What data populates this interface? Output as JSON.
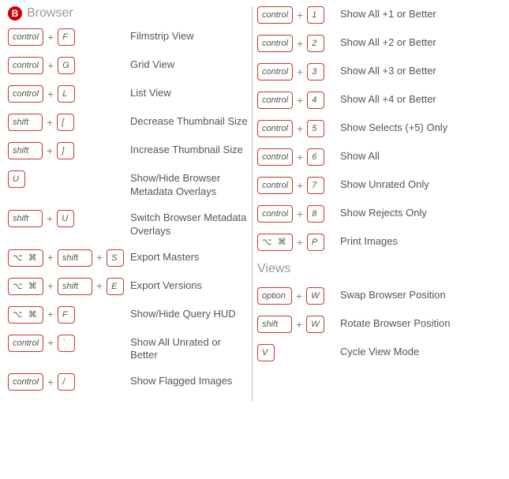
{
  "section": {
    "badge": "B",
    "title": "Browser"
  },
  "views_title": "Views",
  "keys": {
    "control": "control",
    "shift": "shift",
    "option": "option",
    "F": "F",
    "G": "G",
    "L": "L",
    "lbracket": "[",
    "rbracket": "]",
    "U": "U",
    "S": "S",
    "E": "E",
    "backtick": "`",
    "slash": "/",
    "n1": "1",
    "n2": "2",
    "n3": "3",
    "n4": "4",
    "n5": "5",
    "n6": "6",
    "n7": "7",
    "n8": "8",
    "P": "P",
    "W": "W",
    "V": "V"
  },
  "left": [
    {
      "k": [
        "control",
        "+",
        "F"
      ],
      "d": "Filmstrip View"
    },
    {
      "k": [
        "control",
        "+",
        "G"
      ],
      "d": "Grid View"
    },
    {
      "k": [
        "control",
        "+",
        "L"
      ],
      "d": "List View"
    },
    {
      "k": [
        "shift",
        "+",
        "lbracket"
      ],
      "d": "Decrease Thumbnail Size"
    },
    {
      "k": [
        "shift",
        "+",
        "rbracket"
      ],
      "d": "Increase Thumbnail Size"
    },
    {
      "k": [
        "U"
      ],
      "d": "Show/Hide Browser Metadata Overlays"
    },
    {
      "k": [
        "shift",
        "+",
        "U"
      ],
      "d": "Switch Browser Metadata Overlays"
    },
    {
      "k": [
        "optcmd",
        "+",
        "shift",
        "+",
        "S"
      ],
      "d": "Export Masters"
    },
    {
      "k": [
        "optcmd",
        "+",
        "shift",
        "+",
        "E"
      ],
      "d": "Export Versions"
    },
    {
      "k": [
        "optcmd",
        "+",
        "F"
      ],
      "d": "Show/Hide Query HUD"
    },
    {
      "k": [
        "control",
        "+",
        "backtick"
      ],
      "d": "Show All Unrated or Better"
    },
    {
      "k": [
        "control",
        "+",
        "slash"
      ],
      "d": "Show Flagged Images"
    }
  ],
  "right_top": [
    {
      "k": [
        "control",
        "+",
        "n1"
      ],
      "d": "Show All +1 or Better"
    },
    {
      "k": [
        "control",
        "+",
        "n2"
      ],
      "d": "Show All +2 or Better"
    },
    {
      "k": [
        "control",
        "+",
        "n3"
      ],
      "d": "Show All +3 or Better"
    },
    {
      "k": [
        "control",
        "+",
        "n4"
      ],
      "d": "Show All +4 or Better"
    },
    {
      "k": [
        "control",
        "+",
        "n5"
      ],
      "d": "Show Selects (+5) Only"
    },
    {
      "k": [
        "control",
        "+",
        "n6"
      ],
      "d": "Show All"
    },
    {
      "k": [
        "control",
        "+",
        "n7"
      ],
      "d": "Show Unrated Only"
    },
    {
      "k": [
        "control",
        "+",
        "n8"
      ],
      "d": "Show Rejects Only"
    },
    {
      "k": [
        "optcmd",
        "+",
        "P"
      ],
      "d": "Print Images"
    }
  ],
  "right_views": [
    {
      "k": [
        "option",
        "+",
        "W"
      ],
      "d": "Swap Browser Position"
    },
    {
      "k": [
        "shift",
        "+",
        "W"
      ],
      "d": "Rotate Browser Position"
    },
    {
      "k": [
        "V"
      ],
      "d": "Cycle View Mode"
    }
  ]
}
